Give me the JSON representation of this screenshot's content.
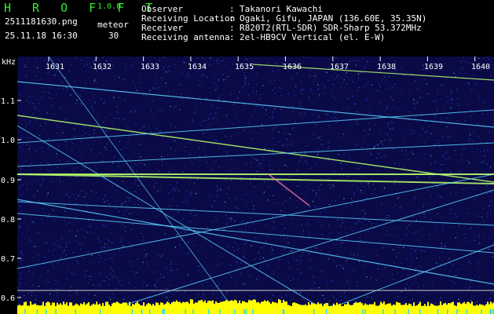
{
  "app": {
    "name": "H R O F F T",
    "version": "1.0.0"
  },
  "file": {
    "name": "2511181630.png",
    "datetime": "25.11.18 16:30"
  },
  "meteor": {
    "label": "meteor",
    "count": "30"
  },
  "info": [
    {
      "label": "Observer",
      "value": "Takanori Kawachi"
    },
    {
      "label": "Receiving Location",
      "value": "Ogaki, Gifu, JAPAN (136.60E, 35.35N)"
    },
    {
      "label": "Receiver",
      "value": "R820T2(RTL-SDR) SDR-Sharp 53.372MHz"
    },
    {
      "label": "Receiving antenna",
      "value": "2el-HB9CV Vertical (el. E-W)"
    }
  ],
  "spectrogram": {
    "y_unit": "kHz",
    "y_ticks": [
      "1.1",
      "1.0",
      "0.9",
      "0.8",
      "0.7",
      "0.6"
    ],
    "x_ticks": [
      "1631",
      "1632",
      "1633",
      "1634",
      "1635",
      "1636",
      "1637",
      "1638",
      "1639",
      "1640"
    ],
    "colors": {
      "background": "#0a0a46",
      "noise": "#2a5cff",
      "trace": "#5ad2ff",
      "hot": "#b6ff6a",
      "baseline": "#ffff00"
    }
  }
}
